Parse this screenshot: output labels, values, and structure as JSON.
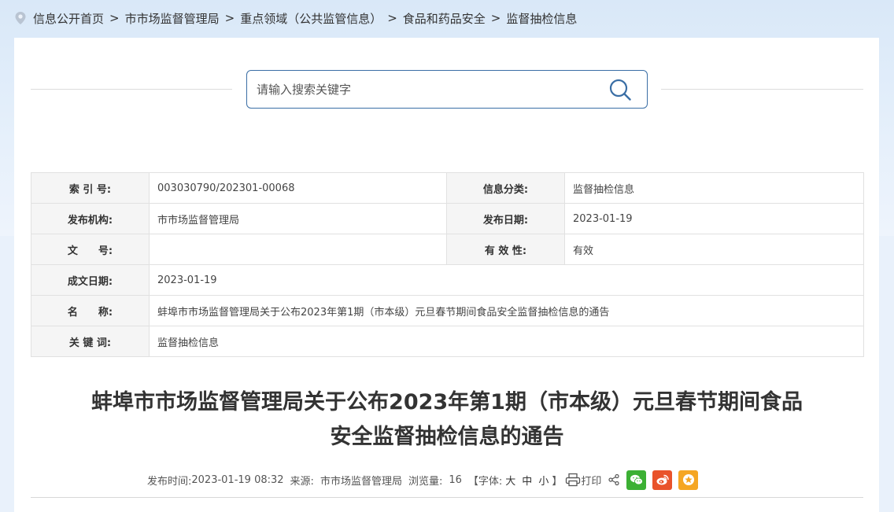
{
  "breadcrumb": {
    "items": [
      "信息公开首页",
      "市市场监督管理局",
      "重点领域（公共监管信息）",
      "食品和药品安全",
      "监督抽检信息"
    ],
    "separator": ">"
  },
  "search": {
    "placeholder": "请输入搜索关键字"
  },
  "info": {
    "index_label": "索 引 号:",
    "index_value": "003030790/202301-00068",
    "category_label": "信息分类:",
    "category_value": "监督抽检信息",
    "publisher_label": "发布机构:",
    "publisher_value": "市市场监督管理局",
    "publish_date_label": "发布日期:",
    "publish_date_value": "2023-01-19",
    "doc_no_label": "文　　号:",
    "doc_no_value": "",
    "validity_label": "有 效 性:",
    "validity_value": "有效",
    "created_date_label": "成文日期:",
    "created_date_value": "2023-01-19",
    "name_label": "名　　称:",
    "name_value": "蚌埠市市场监督管理局关于公布2023年第1期（市本级）元旦春节期间食品安全监督抽检信息的通告",
    "keywords_label": "关 键 词:",
    "keywords_value": "监督抽检信息"
  },
  "article": {
    "title_line1": "蚌埠市市场监督管理局关于公布2023年第1期（市本级）元旦春节期间食品",
    "title_line2": "安全监督抽检信息的通告"
  },
  "meta": {
    "publish_time_label": "发布时间:",
    "publish_time_value": "2023-01-19 08:32",
    "source_label": "来源:",
    "source_value": "市市场监督管理局",
    "views_label": "浏览量:",
    "views_value": "16",
    "font_label": "【字体:",
    "font_large": "大",
    "font_medium": "中",
    "font_small": "小",
    "font_close": "】",
    "print_label": "打印"
  },
  "colors": {
    "search_border": "#3a6ea5",
    "search_icon": "#3a6ea5",
    "wechat": "#3cb034",
    "weibo": "#e9532b",
    "favorite": "#f5a623"
  }
}
